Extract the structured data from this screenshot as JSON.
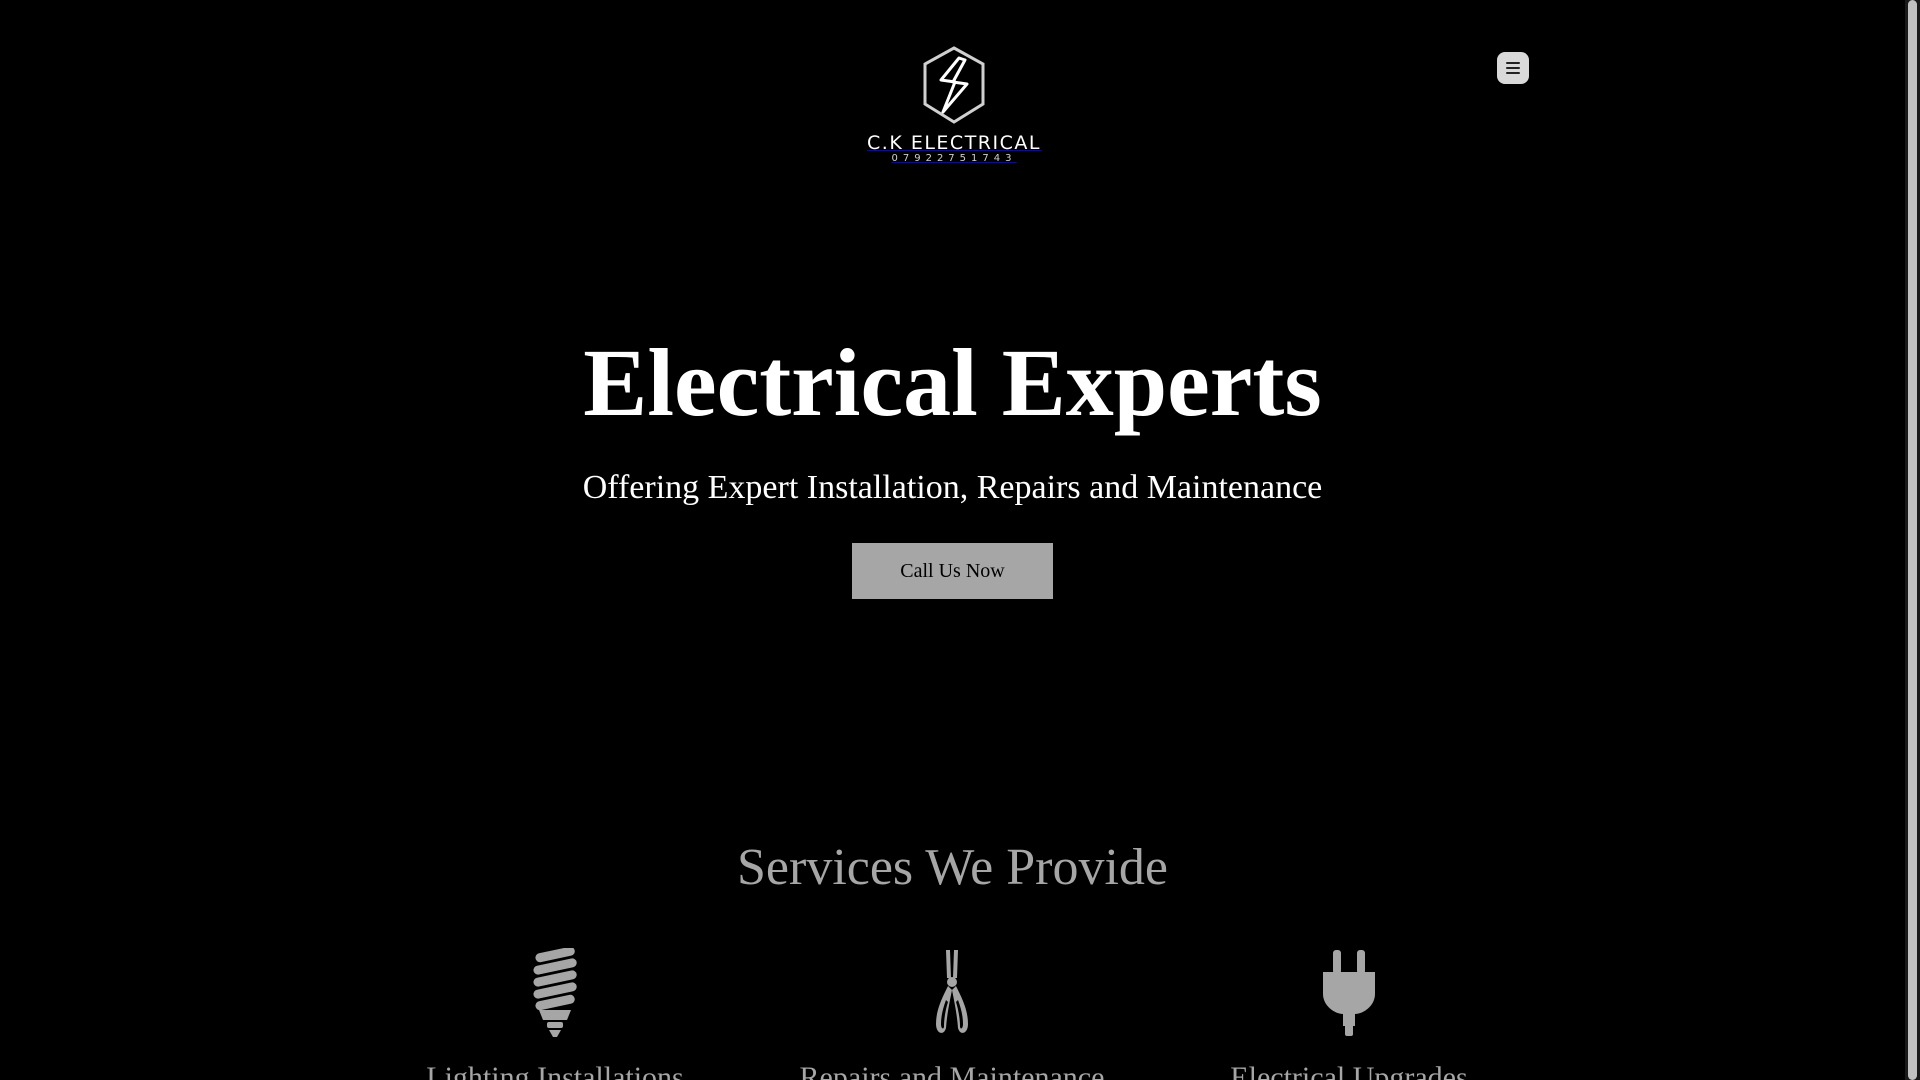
{
  "brand": {
    "name": "C.K ELECTRICAL",
    "phone": "07922751743"
  },
  "header": {
    "menu_icon": "hamburger-menu-icon"
  },
  "hero": {
    "title": "Electrical Experts",
    "subtitle": "Offering Expert Installation, Repairs and Maintenance",
    "cta_label": "Call Us Now"
  },
  "services": {
    "title": "Services We Provide",
    "items": [
      {
        "label": "Lighting Installations",
        "icon": "light-bulb-icon"
      },
      {
        "label": "Repairs and Maintenance",
        "icon": "pliers-icon"
      },
      {
        "label": "Electrical Upgrades",
        "icon": "plug-icon"
      }
    ]
  },
  "colors": {
    "background": "#000000",
    "text_primary": "#ffffff",
    "accent_grey": "#a6a6a6",
    "menu_button": "#d9d9d9"
  }
}
